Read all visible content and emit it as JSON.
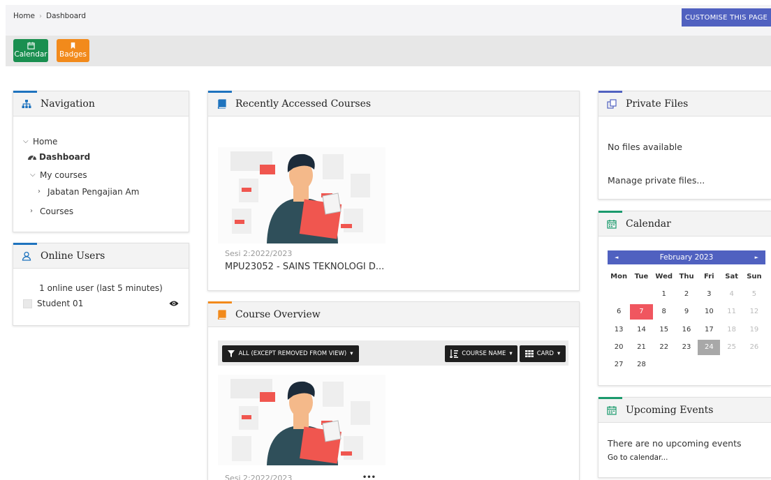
{
  "breadcrumb": {
    "home": "Home",
    "separator": "›",
    "current": "Dashboard"
  },
  "header": {
    "customise_label": "CUSTOMISE THIS PAGE"
  },
  "quickbar": {
    "calendar_label": "Calendar",
    "badges_label": "Badges"
  },
  "navigation": {
    "title": "Navigation",
    "home": "Home",
    "dashboard": "Dashboard",
    "my_courses": "My courses",
    "course_category": "Jabatan Pengajian Am",
    "courses": "Courses"
  },
  "online_users": {
    "title": "Online Users",
    "summary": "1 online user (last 5 minutes)",
    "users": [
      "Student 01"
    ]
  },
  "recent_courses": {
    "title": "Recently Accessed Courses",
    "course": {
      "session": "Sesi 2:2022/2023",
      "name": "MPU23052 - SAINS TEKNOLOGI D..."
    }
  },
  "course_overview": {
    "title": "Course Overview",
    "filter_label": "ALL (EXCEPT REMOVED FROM VIEW)",
    "sort_label": "COURSE NAME",
    "view_label": "CARD",
    "course": {
      "session": "Sesi 2:2022/2023",
      "menu": "•••"
    }
  },
  "private_files": {
    "title": "Private Files",
    "empty_text": "No files available",
    "manage_link": "Manage private files..."
  },
  "calendar": {
    "title": "Calendar",
    "month": "February 2023",
    "prev": "◄",
    "next": "►",
    "days": [
      "Mon",
      "Tue",
      "Wed",
      "Thu",
      "Fri",
      "Sat",
      "Sun"
    ],
    "weeks": [
      [
        "",
        "",
        "1",
        "2",
        "3",
        "4",
        "5"
      ],
      [
        "6",
        "7",
        "8",
        "9",
        "10",
        "11",
        "12"
      ],
      [
        "13",
        "14",
        "15",
        "16",
        "17",
        "18",
        "19"
      ],
      [
        "20",
        "21",
        "22",
        "23",
        "24",
        "25",
        "26"
      ],
      [
        "27",
        "28",
        "",
        "",
        "",
        "",
        ""
      ]
    ],
    "today": "7",
    "selected": "24"
  },
  "upcoming_events": {
    "title": "Upcoming Events",
    "empty_text": "There are no upcoming events",
    "link": "Go to calendar..."
  },
  "colors": {
    "primary": "#5061c0",
    "calendar_button": "#1a8f50",
    "badges_button": "#f28a1b",
    "navigation_accent": "#1e73be",
    "courses_accent": "#1e73be",
    "overview_accent": "#f28a1b",
    "private_files_accent": "#5061c0",
    "calendar_accent": "#1a9a6c",
    "today": "#f0565f"
  },
  "icons": {
    "navigation": "sitemap-icon",
    "online_users": "user-icon",
    "recent_courses": "book-icon",
    "course_overview": "book-icon",
    "private_files": "files-icon",
    "calendar": "calendar-icon",
    "upcoming_events": "calendar-icon",
    "dashboard": "dashboard-icon",
    "visibility": "eye-icon"
  }
}
